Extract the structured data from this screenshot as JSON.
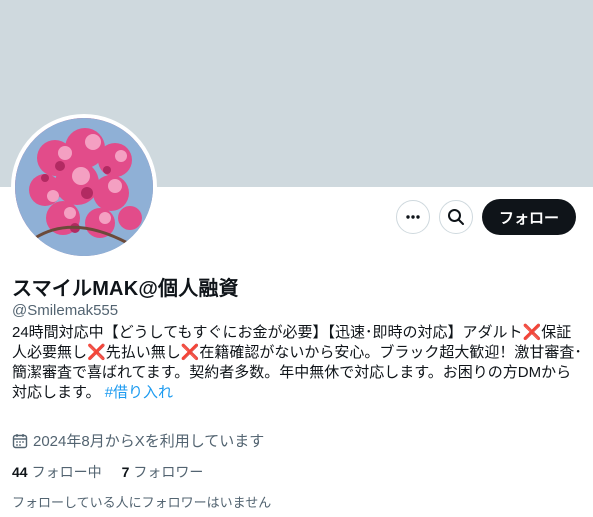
{
  "profile": {
    "display_name": "スマイルMAK@個人融資",
    "handle": "@Smilemak555",
    "bio": {
      "text_1": "24時間対応中【どうしてもすぐにお金が必要】【迅速･即時の対応】アダルト",
      "mark": "❌",
      "text_2": "保証人必要無し",
      "text_3": "先払い無し",
      "text_4": "在籍確認がないから安心。ブラック超大歓迎！激甘審査･簡潔審査で喜ばれてます。契約者多数。年中無休で対応します。お困りの方DMから対応します。",
      "hashtag": "#借り入れ"
    },
    "joined": "2024年8月からXを利用しています",
    "following_count": "44",
    "following_label": "フォロー中",
    "followers_count": "7",
    "followers_label": "フォロワー",
    "mutual_note": "フォローしている人にフォロワーはいません"
  },
  "actions": {
    "follow_label": "フォロー",
    "more_icon": "more-horizontal-icon",
    "search_icon": "search-icon"
  },
  "colors": {
    "banner": "#cfd9de",
    "accent_link": "#1d9bf0",
    "follow_button": "#0f1419",
    "muted_text": "#536471",
    "cross_mark": "#dd2e44"
  }
}
